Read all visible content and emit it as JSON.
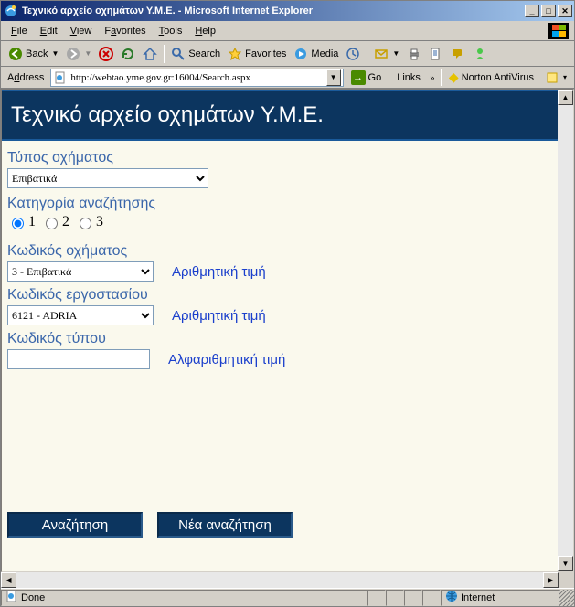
{
  "window": {
    "title": "Τεχνικό αρχείο οχημάτων Υ.Μ.Ε. - Microsoft Internet Explorer"
  },
  "menu": {
    "file": "File",
    "edit": "Edit",
    "view": "View",
    "favorites": "Favorites",
    "tools": "Tools",
    "help": "Help"
  },
  "toolbar": {
    "back": "Back",
    "search": "Search",
    "favorites": "Favorites",
    "media": "Media"
  },
  "address": {
    "label": "Address",
    "url": "http://webtao.yme.gov.gr:16004/Search.aspx",
    "go": "Go",
    "links": "Links",
    "norton": "Norton AntiVirus"
  },
  "page": {
    "header": "Τεχνικό αρχείο οχημάτων Υ.Μ.Ε.",
    "vehicle_type_label": "Τύπος οχήματος",
    "vehicle_type_value": "Επιβατικά",
    "search_category_label": "Κατηγορία αναζήτησης",
    "radios": {
      "r1": "1",
      "r2": "2",
      "r3": "3"
    },
    "vehicle_code_label": "Κωδικός οχήματος",
    "vehicle_code_value": "3 - Επιβατικά",
    "numeric_hint": "Αριθμητική τιμή",
    "factory_code_label": "Κωδικός εργοστασίου",
    "factory_code_value": "6121 - ADRIA",
    "type_code_label": "Κωδικός τύπου",
    "type_code_value": "",
    "alpha_hint": "Αλφαριθμητική τιμή",
    "search_btn": "Αναζήτηση",
    "new_search_btn": "Νέα αναζήτηση"
  },
  "status": {
    "done": "Done",
    "zone": "Internet"
  }
}
